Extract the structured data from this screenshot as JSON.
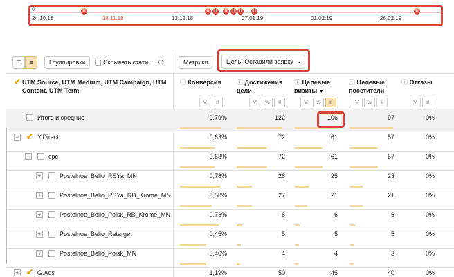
{
  "timeline": {
    "zero_label": "0",
    "dates": [
      "24.10.18",
      "18.11.18",
      "13.12.18",
      "07.01.19",
      "01.02.19",
      "26.02.19"
    ],
    "highlighted_date": "18.11.18",
    "pin_letter": "Н"
  },
  "toolbar": {
    "groupings_label": "Группировки",
    "hide_stats_label": "Скрывать стати...",
    "metrics_label": "Метрики",
    "goal_label": "Цель: Оставили заявку"
  },
  "table": {
    "dimension_header": "UTM Source, UTM Medium, UTM Campaign, UTM Content, UTM Term",
    "columns": [
      {
        "label": "Конверсия"
      },
      {
        "label": "Достижения цели"
      },
      {
        "label": "Целевые визиты",
        "sort": "▼"
      },
      {
        "label": "Целевые посетители"
      },
      {
        "label": "Отказы"
      }
    ],
    "rows": [
      {
        "name": "Итого и средние",
        "conv": "0,79%",
        "goals": "122",
        "visits": "106",
        "visitors": "97",
        "bounce": "0%"
      },
      {
        "name": "Y.Direct",
        "conv": "0,63%",
        "goals": "72",
        "visits": "61",
        "visitors": "57",
        "bounce": "0%"
      },
      {
        "name": "cpc",
        "conv": "0,63%",
        "goals": "72",
        "visits": "61",
        "visitors": "57",
        "bounce": "0%"
      },
      {
        "name": "Postelnoe_Belio_RSYa_MN",
        "conv": "0,78%",
        "goals": "28",
        "visits": "25",
        "visitors": "23",
        "bounce": "0%"
      },
      {
        "name": "Postelnoe_Belio_RSYa_RB_Krome_MN",
        "conv": "0,58%",
        "goals": "27",
        "visits": "21",
        "visitors": "21",
        "bounce": "0%"
      },
      {
        "name": "Postelnoe_Belio_Poisk_RB_Krome_MN",
        "conv": "0,73%",
        "goals": "8",
        "visits": "6",
        "visitors": "6",
        "bounce": "0%"
      },
      {
        "name": "Postelnoe_Belio_Retarget",
        "conv": "0,45%",
        "goals": "5",
        "visits": "5",
        "visitors": "5",
        "bounce": "0%"
      },
      {
        "name": "Postelnoe_Belio_Poisk_MN",
        "conv": "0,46%",
        "goals": "4",
        "visits": "4",
        "visitors": "3",
        "bounce": "0%"
      },
      {
        "name": "G.Ads",
        "conv": "1,19%",
        "goals": "50",
        "visits": "45",
        "visitors": "40",
        "bounce": "0%"
      }
    ]
  },
  "colors": {
    "accent": "#d6453d",
    "bar": "#f3d79e",
    "check": "#e8a317"
  }
}
